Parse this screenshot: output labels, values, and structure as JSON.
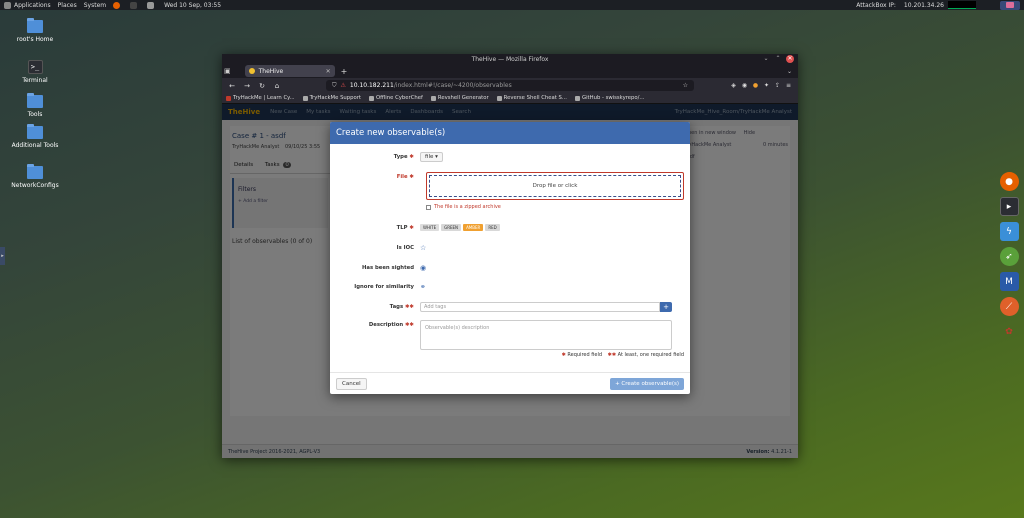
{
  "topbar": {
    "applications": "Applications",
    "places": "Places",
    "system": "System",
    "datetime": "Wed 10 Sep, 03:55",
    "attackbox_label": "AttackBox IP:",
    "attackbox_ip": "10.201.34.26"
  },
  "desktop": {
    "icons": [
      {
        "label": "root's Home"
      },
      {
        "label": "Terminal"
      },
      {
        "label": "Tools"
      },
      {
        "label": "Additional Tools"
      },
      {
        "label": "NetworkConfigs"
      }
    ]
  },
  "firefox": {
    "window_title": "TheHive — Mozilla Firefox",
    "tab_title": "TheHive",
    "url_host": "10.10.182.211",
    "url_path": "/index.html#!/case/~4200/observables",
    "bookmarks": [
      "TryHackMe | Learn Cy...",
      "TryHackMe Support",
      "Offline CyberChef",
      "Revshell Generator",
      "Reverse Shell Cheat S...",
      "GitHub - swisskyrepo/..."
    ]
  },
  "hive": {
    "logo": "TheHive",
    "nav": [
      "New Case",
      "My tasks",
      "Waiting tasks",
      "Alerts",
      "Dashboards",
      "Search"
    ],
    "user": "TryHackMe_Hive_Room/TryHackMe Analyst",
    "case_title": "Case # 1 - asdf",
    "case_meta": "TryHackMe Analyst",
    "case_date": "09/10/25 3:55",
    "tab_details": "Details",
    "tab_tasks": "Tasks",
    "tasks_count": "0",
    "filters_title": "Filters",
    "add_filter": "+ Add a filter",
    "list_observables": "List of observables (0 of 0)",
    "right_open": "Open in new window",
    "right_hide": "Hide",
    "right_analyst": "TryHackMe Analyst",
    "right_minutes": "0 minutes",
    "right_asdf": "asdf",
    "footer_left": "TheHive Project 2016-2021, AGPL-V3",
    "footer_version_label": "Version:",
    "footer_version": "4.1.21-1"
  },
  "modal": {
    "title": "Create new observable(s)",
    "type_label": "Type",
    "type_value": "file",
    "file_label": "File",
    "dropzone_text": "Drop file or click",
    "zipped_label": "The file is a zipped archive",
    "tlp_label": "TLP",
    "tlp_options": [
      "WHITE",
      "GREEN",
      "AMBER",
      "RED"
    ],
    "tlp_selected": "AMBER",
    "ioc_label": "Is IOC",
    "sighted_label": "Has been sighted",
    "ignore_label": "Ignore for similarity",
    "tags_label": "Tags",
    "tags_placeholder": "Add tags",
    "desc_label": "Description",
    "desc_placeholder": "Observable(s) description",
    "legend_required": "Required field",
    "legend_atleast": "At least, one required field",
    "cancel": "Cancel",
    "create": "+ Create observable(s)"
  }
}
